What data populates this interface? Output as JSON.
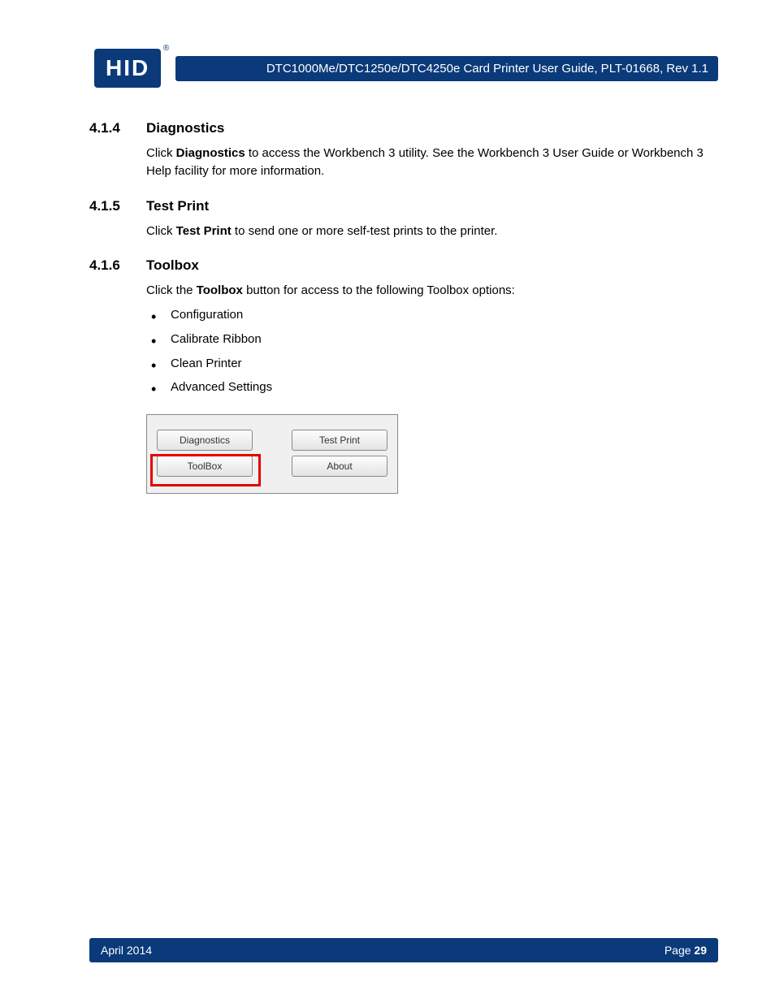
{
  "header": {
    "logo_text": "HID",
    "reg_mark": "®",
    "bar_text": "DTC1000Me/DTC1250e/DTC4250e Card Printer User Guide, PLT-01668, Rev 1.1"
  },
  "sections": {
    "s414": {
      "num": "4.1.4",
      "title": "Diagnostics",
      "body_pre": "Click ",
      "body_bold": "Diagnostics",
      "body_post": " to access the Workbench 3 utility. See the Workbench 3 User Guide or Workbench 3 Help facility for more information."
    },
    "s415": {
      "num": "4.1.5",
      "title": "Test Print",
      "body_pre": "Click ",
      "body_bold": "Test Print",
      "body_post": " to send one or more self-test prints to the printer."
    },
    "s416": {
      "num": "4.1.6",
      "title": "Toolbox",
      "body_pre": "Click the ",
      "body_bold": "Toolbox",
      "body_post": " button for access to the following Toolbox options:",
      "options": [
        "Configuration",
        "Calibrate Ribbon",
        "Clean Printer",
        "Advanced Settings"
      ]
    }
  },
  "dialog": {
    "btn1": "Diagnostics",
    "btn2": "Test Print",
    "btn3": "ToolBox",
    "btn4": "About"
  },
  "footer": {
    "date": "April 2014",
    "page_label": "Page ",
    "page_num": "29"
  }
}
